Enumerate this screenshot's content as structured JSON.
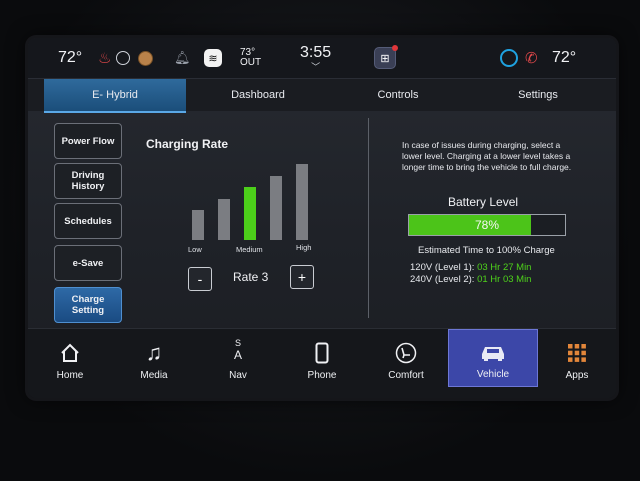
{
  "status": {
    "temp_left": "72°",
    "outside_temp": "73°",
    "outside_label": "OUT",
    "time": "3:55",
    "temp_right": "72°",
    "icons": [
      "heated-seat-icon",
      "steering-heat-icon",
      "heated-wheel-icon",
      "notification-bell-icon",
      "wifi-icon",
      "apps-icon",
      "voice-assistant-icon",
      "phone-icon"
    ]
  },
  "tabs": [
    {
      "label": "E- Hybrid",
      "active": true
    },
    {
      "label": "Dashboard",
      "active": false
    },
    {
      "label": "Controls",
      "active": false
    },
    {
      "label": "Settings",
      "active": false
    }
  ],
  "menu": [
    {
      "label": "Power Flow",
      "active": false
    },
    {
      "label": "Driving History",
      "active": false
    },
    {
      "label": "Schedules",
      "active": false
    },
    {
      "label": "e-Save",
      "active": false
    },
    {
      "label": "Charge Setting",
      "active": true
    }
  ],
  "charging_rate": {
    "title": "Charging Rate",
    "levels": 5,
    "selected_level": 3,
    "labels": {
      "low": "Low",
      "medium": "Medium",
      "high": "High"
    },
    "rate_label": "Rate 3",
    "minus": "-",
    "plus": "+"
  },
  "battery": {
    "info_text": "In case of issues during charging, select a lower level. Charging at a lower level takes a longer time to bring the vehicle to full charge.",
    "title": "Battery Level",
    "level_percent": 78,
    "level_text": "78%",
    "estimate_title": "Estimated Time to 100% Charge",
    "level1_label": "120V (Level 1):",
    "level1_time": "03 Hr 27 Min",
    "level2_label": "240V (Level 2):",
    "level2_time": "01 Hr 03 Min"
  },
  "nav": [
    {
      "label": "Home",
      "icon": "home-icon",
      "active": false
    },
    {
      "label": "Media",
      "icon": "music-note-icon",
      "active": false
    },
    {
      "label": "Nav",
      "icon": "compass-icon",
      "active": false,
      "compass": [
        "S",
        "A"
      ]
    },
    {
      "label": "Phone",
      "icon": "smartphone-icon",
      "active": false
    },
    {
      "label": "Comfort",
      "icon": "seat-icon",
      "active": false
    },
    {
      "label": "Vehicle",
      "icon": "car-icon",
      "active": true
    },
    {
      "label": "Apps",
      "icon": "grid-icon",
      "active": false
    }
  ],
  "colors": {
    "accent_blue": "#2f6a9c",
    "green": "#4ccf1a",
    "nav_active": "#3c47a8"
  }
}
